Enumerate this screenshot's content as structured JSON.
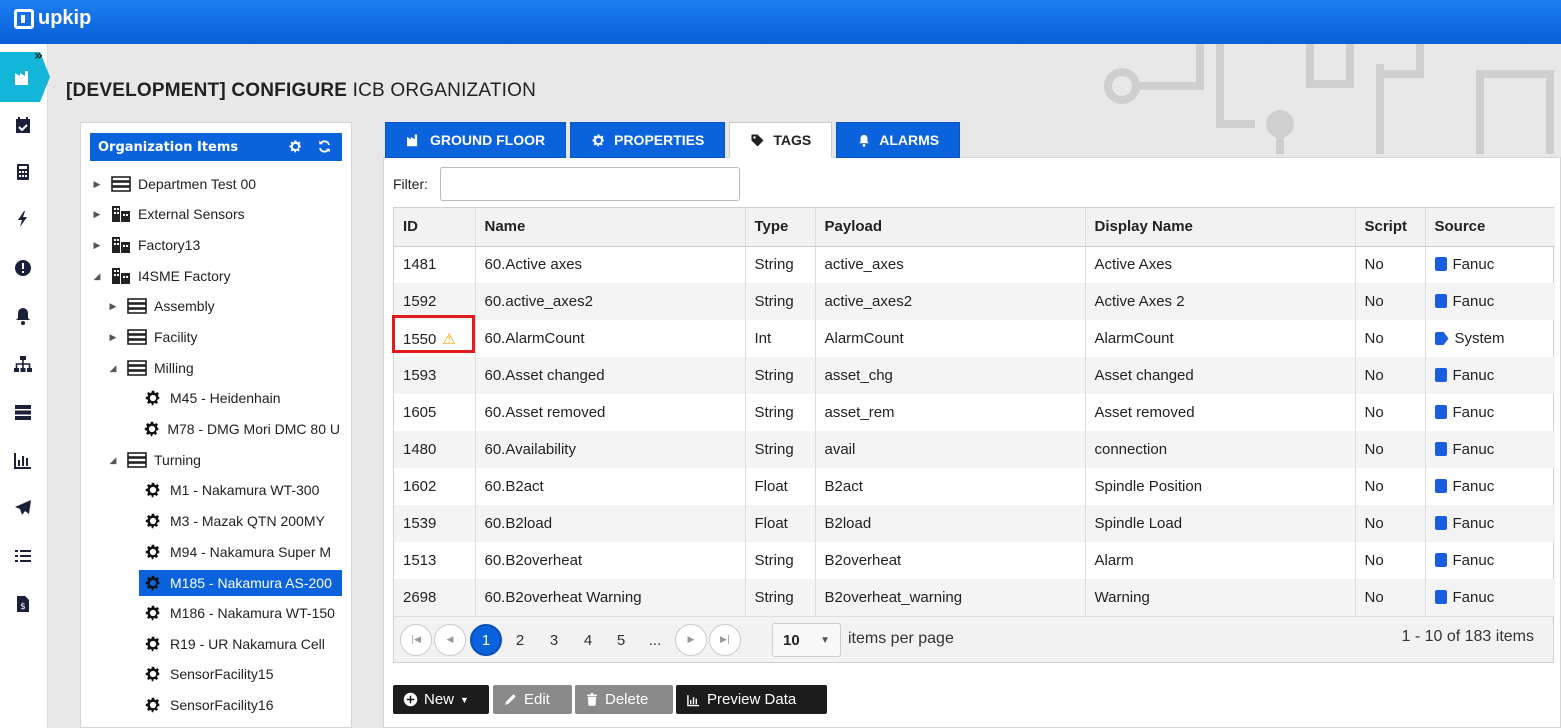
{
  "app": {
    "logo_text": "upkip"
  },
  "title": {
    "prefix": "[DEVELOPMENT] CONFIGURE",
    "suffix": "ICB ORGANIZATION"
  },
  "tree": {
    "header": "Organization Items",
    "items": [
      {
        "label": "Departmen Test 00",
        "icon": "server-icon"
      },
      {
        "label": "External Sensors",
        "icon": "building-icon"
      },
      {
        "label": "Factory13",
        "icon": "building-icon"
      },
      {
        "label": "I4SME Factory",
        "icon": "building-icon"
      },
      {
        "label": "Assembly",
        "icon": "server-icon"
      },
      {
        "label": "Facility",
        "icon": "server-icon"
      },
      {
        "label": "Milling",
        "icon": "server-icon"
      },
      {
        "label": "M45 - Heidenhain",
        "icon": "gear-icon"
      },
      {
        "label": "M78 - DMG Mori DMC 80 U",
        "icon": "gear-icon"
      },
      {
        "label": "Turning",
        "icon": "server-icon"
      },
      {
        "label": "M1 - Nakamura WT-300",
        "icon": "gear-icon"
      },
      {
        "label": "M3 - Mazak QTN 200MY",
        "icon": "gear-icon"
      },
      {
        "label": "M94 - Nakamura Super M",
        "icon": "gear-icon"
      },
      {
        "label": "M185 - Nakamura AS-200",
        "icon": "gear-icon"
      },
      {
        "label": "M186 - Nakamura WT-150",
        "icon": "gear-icon"
      },
      {
        "label": "R19 - UR Nakamura Cell",
        "icon": "gear-icon"
      },
      {
        "label": "SensorFacility15",
        "icon": "gear-icon"
      },
      {
        "label": "SensorFacility16",
        "icon": "gear-icon"
      }
    ]
  },
  "tabs": [
    {
      "label": "GROUND FLOOR",
      "icon": "factory-icon"
    },
    {
      "label": "PROPERTIES",
      "icon": "gear-icon"
    },
    {
      "label": "TAGS",
      "icon": "tag-icon"
    },
    {
      "label": "ALARMS",
      "icon": "bell-icon"
    }
  ],
  "filter": {
    "label": "Filter:",
    "value": ""
  },
  "grid": {
    "columns": [
      "ID",
      "Name",
      "Type",
      "Payload",
      "Display Name",
      "Script",
      "Source"
    ],
    "rows": [
      {
        "id": "1481",
        "name": "60.Active axes",
        "type": "String",
        "payload": "active_axes",
        "display": "Active Axes",
        "script": "No",
        "source": "Fanuc"
      },
      {
        "id": "1592",
        "name": "60.active_axes2",
        "type": "String",
        "payload": "active_axes2",
        "display": "Active Axes 2",
        "script": "No",
        "source": "Fanuc"
      },
      {
        "id": "1550",
        "name": "60.AlarmCount",
        "type": "Int",
        "payload": "AlarmCount",
        "display": "AlarmCount",
        "script": "No",
        "source": "System"
      },
      {
        "id": "1593",
        "name": "60.Asset changed",
        "type": "String",
        "payload": "asset_chg",
        "display": "Asset changed",
        "script": "No",
        "source": "Fanuc"
      },
      {
        "id": "1605",
        "name": "60.Asset removed",
        "type": "String",
        "payload": "asset_rem",
        "display": "Asset removed",
        "script": "No",
        "source": "Fanuc"
      },
      {
        "id": "1480",
        "name": "60.Availability",
        "type": "String",
        "payload": "avail",
        "display": "connection",
        "script": "No",
        "source": "Fanuc"
      },
      {
        "id": "1602",
        "name": "60.B2act",
        "type": "Float",
        "payload": "B2act",
        "display": "Spindle Position",
        "script": "No",
        "source": "Fanuc"
      },
      {
        "id": "1539",
        "name": "60.B2load",
        "type": "Float",
        "payload": "B2load",
        "display": "Spindle Load",
        "script": "No",
        "source": "Fanuc"
      },
      {
        "id": "1513",
        "name": "60.B2overheat",
        "type": "String",
        "payload": "B2overheat",
        "display": "Alarm",
        "script": "No",
        "source": "Fanuc"
      },
      {
        "id": "2698",
        "name": "60.B2overheat Warning",
        "type": "String",
        "payload": "B2overheat_warning",
        "display": "Warning",
        "script": "No",
        "source": "Fanuc"
      }
    ]
  },
  "pager": {
    "pages": [
      "1",
      "2",
      "3",
      "4",
      "5",
      "..."
    ],
    "current": "1",
    "page_size": "10",
    "items_per_page_label": "items per page",
    "summary": "1 - 10 of 183 items"
  },
  "buttons": {
    "new": "New",
    "edit": "Edit",
    "delete": "Delete",
    "preview": "Preview Data"
  },
  "colors": {
    "primary": "#0a63dc",
    "accent": "#13b5d9",
    "warning": "#f0a500",
    "highlight": "#e01b1b"
  }
}
